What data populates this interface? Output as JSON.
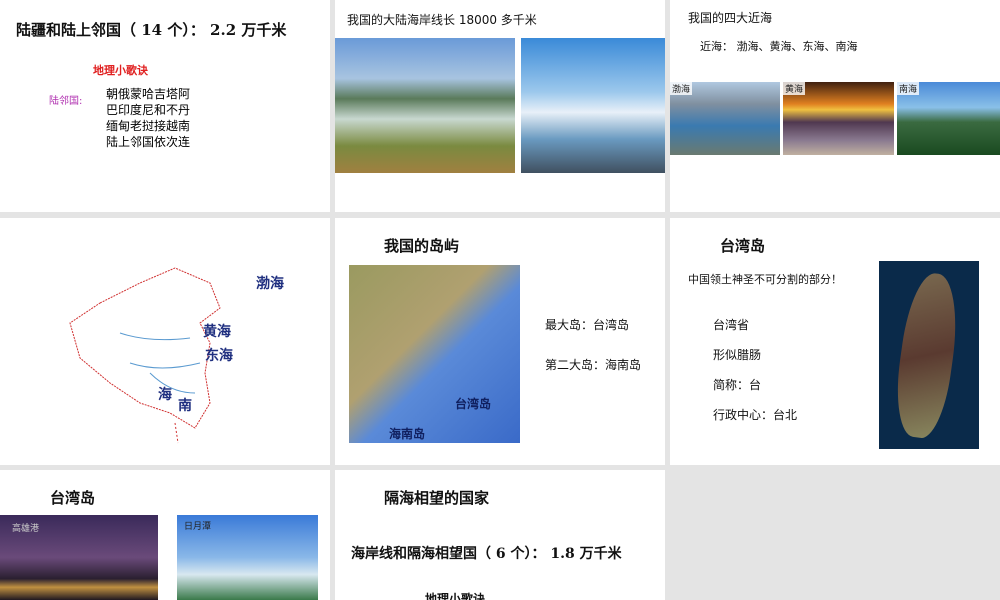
{
  "slides": [
    {
      "title": "陆疆和陆上邻国（ 14 个）： 2.2 万千米",
      "song_title": "地理小歌诀",
      "label": "陆邻国:",
      "lines": [
        "朝俄蒙哈吉塔阿",
        "巴印度尼和不丹",
        "缅甸老挝接越南",
        "陆上邻国依次连"
      ]
    },
    {
      "title": "我国的大陆海岸线长 18000 多千米"
    },
    {
      "title": "我国的四大近海",
      "line": "近海：  渤海、黄海、东海、南海",
      "photos": [
        "渤海",
        "黄海",
        "南海"
      ]
    },
    {
      "seas": [
        "渤海",
        "黄海",
        "东海",
        "海",
        "南"
      ]
    },
    {
      "title": "我国的岛屿",
      "largest": "最大岛：台湾岛",
      "second": "第二大岛：海南岛",
      "map_labels": [
        "台湾岛",
        "海南岛"
      ]
    },
    {
      "title": "台湾岛",
      "subtitle": "中国领土神圣不可分割的部分！",
      "facts": [
        "台湾省",
        "形似腊肠",
        "简称：台",
        "行政中心：台北"
      ]
    },
    {
      "title": "台湾岛",
      "photos": [
        "高雄港",
        "日月潭"
      ]
    },
    {
      "title": "隔海相望的国家",
      "line": "海岸线和隔海相望国（ 6 个）： 1.8 万千米",
      "song_title": "地理小歌诀"
    }
  ]
}
